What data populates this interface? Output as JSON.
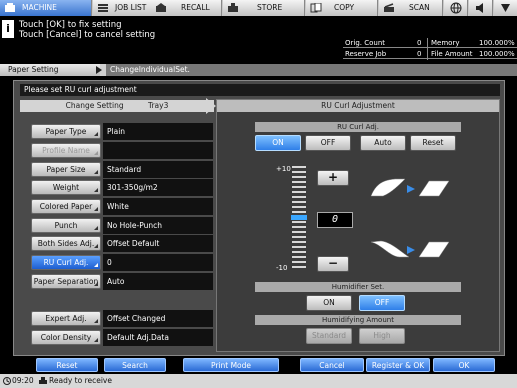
{
  "tabs": [
    {
      "label": "MACHINE",
      "icon": "machine-icon"
    },
    {
      "label": "JOB LIST",
      "icon": "job-list-icon"
    },
    {
      "label": "RECALL",
      "icon": "recall-icon"
    },
    {
      "label": "STORE",
      "icon": "store-icon"
    },
    {
      "label": "COPY",
      "icon": "copy-icon"
    },
    {
      "label": "SCAN",
      "icon": "scan-icon"
    }
  ],
  "message": {
    "line1": "Touch [OK] to fix setting",
    "line2": "Touch [Cancel] to cancel setting"
  },
  "counters": {
    "orig_count_label": "Orig. Count",
    "orig_count_value": "0",
    "reserve_job_label": "Reserve Job",
    "reserve_job_value": "0",
    "memory_label": "Memory",
    "memory_value": "100.000%",
    "file_amount_label": "File Amount",
    "file_amount_value": "100.000%"
  },
  "breadcrumb": {
    "parent": "Paper Setting",
    "current": "ChangeIndividualSet."
  },
  "panel": {
    "prompt": "Please set RU curl adjustment",
    "left_header": "Change Setting",
    "left_tray": "Tray3",
    "right_header": "RU Curl Adjustment"
  },
  "settings": [
    {
      "label": "Paper Type",
      "value": "Plain"
    },
    {
      "label": "Profile Name",
      "value": ""
    },
    {
      "label": "Paper Size",
      "value": "Standard"
    },
    {
      "label": "Weight",
      "value": "301-350g/m2"
    },
    {
      "label": "Colored Paper",
      "value": "White"
    },
    {
      "label": "Punch",
      "value": "No Hole-Punch"
    },
    {
      "label": "Both Sides Adj.",
      "value": "Offset Default"
    },
    {
      "label": "RU Curl Adj.",
      "value": "0"
    },
    {
      "label": "Paper Separation",
      "value": "Auto"
    },
    {
      "label": "Expert Adj.",
      "value": "Offset Changed"
    },
    {
      "label": "Color Density",
      "value": "Default Adj.Data"
    }
  ],
  "ru_curl": {
    "section_label": "RU Curl Adj.",
    "on_label": "ON",
    "off_label": "OFF",
    "auto_label": "Auto",
    "reset_label": "Reset",
    "scale_max": "+10",
    "scale_min": "-10",
    "value": "0",
    "plus_label": "+",
    "minus_label": "−"
  },
  "humidifier": {
    "section_label": "Humidifier Set.",
    "on_label": "ON",
    "off_label": "OFF",
    "amount_label": "Humidifying Amount",
    "standard_label": "Standard",
    "high_label": "High"
  },
  "bottom_buttons": {
    "reset": "Reset",
    "search": "Search",
    "print_mode": "Print Mode",
    "cancel": "Cancel",
    "register_ok": "Register & OK",
    "ok": "OK"
  },
  "status": {
    "time": "09:20",
    "text": "Ready to receive"
  },
  "colors": {
    "accent": "#2f7fe8",
    "active_tab": "#3a74cf"
  }
}
